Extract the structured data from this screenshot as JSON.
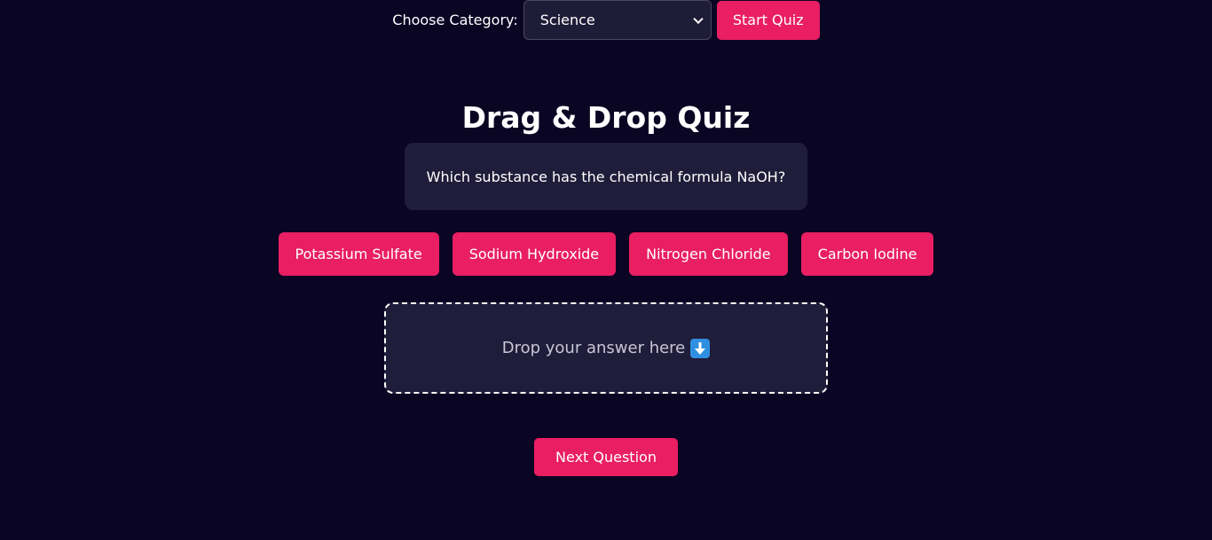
{
  "header": {
    "category_label": "Choose Category:",
    "category_selected": "Science",
    "start_label": "Start Quiz"
  },
  "quiz": {
    "title": "Drag & Drop Quiz",
    "question": "Which substance has the chemical formula NaOH?",
    "options": [
      "Potassium Sulfate",
      "Sodium Hydroxide",
      "Nitrogen Chloride",
      "Carbon Iodine"
    ],
    "drop_zone_text": "Drop your answer here",
    "drop_zone_icon": "down-arrow-icon",
    "next_label": "Next Question"
  },
  "colors": {
    "background": "#0b0524",
    "accent": "#e91e63",
    "panel": "#201d3a"
  }
}
